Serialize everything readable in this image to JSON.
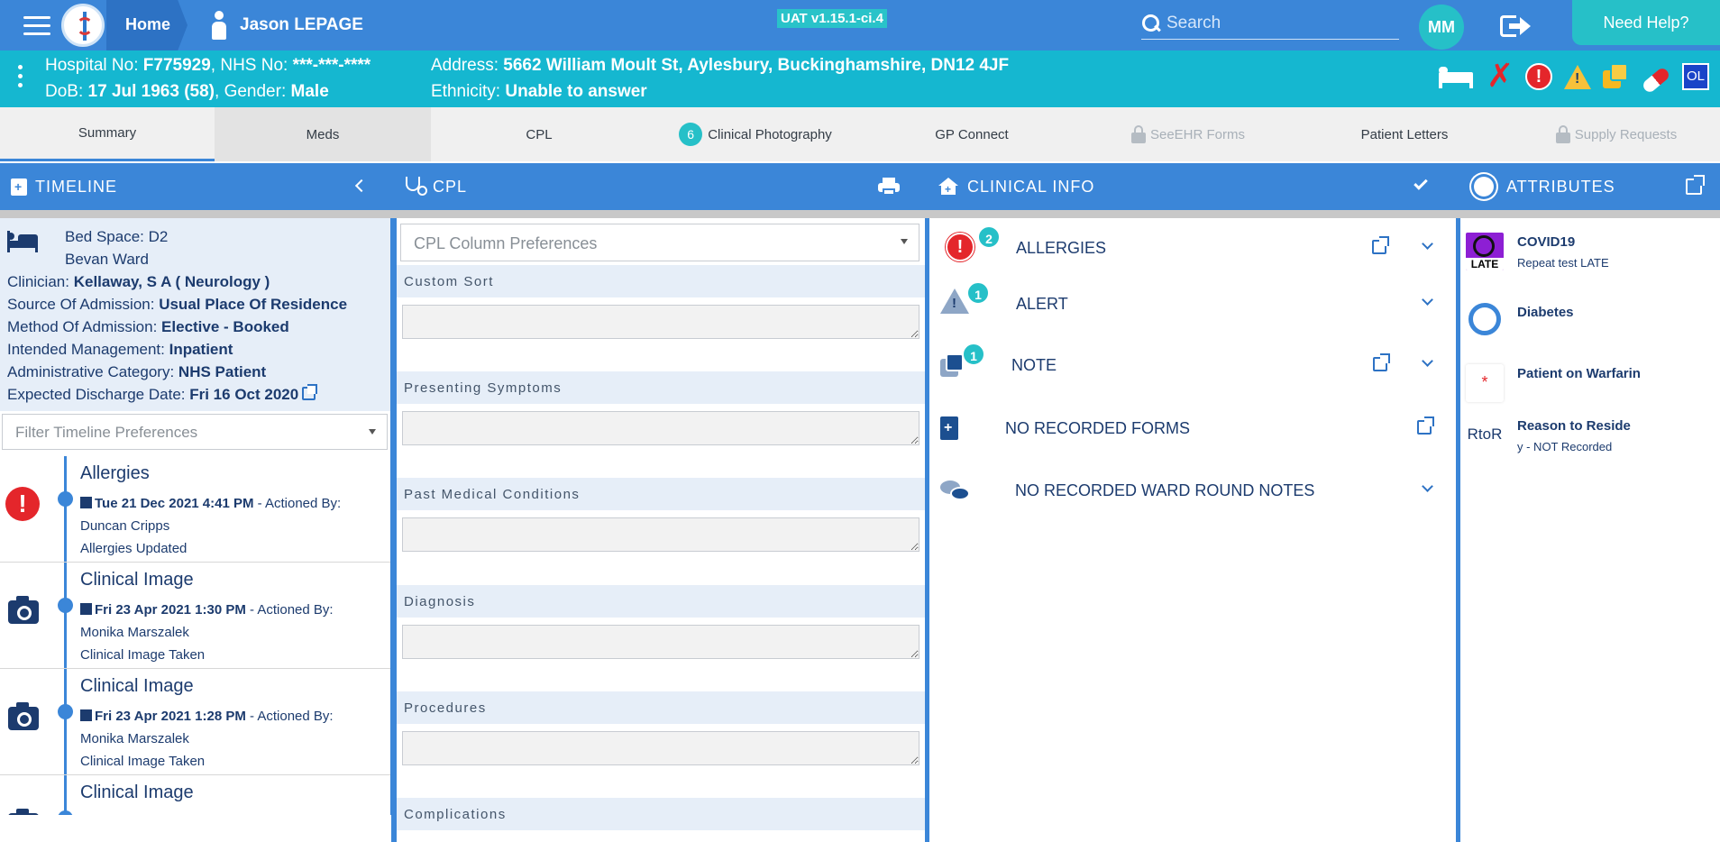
{
  "topbar": {
    "home_label": "Home",
    "patient_name": "Jason LEPAGE",
    "version": "UAT v1.15.1-ci.4",
    "search_placeholder": "Search",
    "avatar_initials": "MM",
    "help_label": "Need Help?"
  },
  "banner": {
    "hospital_label": "Hospital No:",
    "hospital_no": "F775929",
    "nhs_label": "NHS No:",
    "nhs_no": "***-***-****",
    "dob_label": "DoB:",
    "dob": "17 Jul 1963 (58)",
    "gender_label": "Gender:",
    "gender": "Male",
    "address_label": "Address:",
    "address": "5662 William Moult St, Aylesbury, Buckinghamshire, DN12 4JF",
    "ethnicity_label": "Ethnicity:",
    "ethnicity": "Unable to answer",
    "ol_badge": "OL"
  },
  "tabs": [
    {
      "label": "Summary",
      "badge": ""
    },
    {
      "label": "Meds",
      "badge": ""
    },
    {
      "label": "CPL",
      "badge": ""
    },
    {
      "label": "Clinical Photography",
      "badge": "6"
    },
    {
      "label": "GP Connect",
      "badge": ""
    },
    {
      "label": "SeeEHR Forms",
      "badge": ""
    },
    {
      "label": "Patient Letters",
      "badge": ""
    },
    {
      "label": "Supply Requests",
      "badge": ""
    }
  ],
  "panels": {
    "timeline_title": "TIMELINE",
    "cpl_title": "CPL",
    "clinical_title": "CLINICAL INFO",
    "attributes_title": "ATTRIBUTES"
  },
  "timeline": {
    "bed_space_label": "Bed Space:",
    "bed_space": "D2",
    "ward": "Bevan Ward",
    "clinician_label": "Clinician:",
    "clinician": "Kellaway, S A ( Neurology )",
    "source_label": "Source Of Admission:",
    "source": "Usual Place Of Residence",
    "method_label": "Method Of Admission:",
    "method": "Elective - Booked",
    "management_label": "Intended Management:",
    "management": "Inpatient",
    "category_label": "Administrative Category:",
    "category": "NHS Patient",
    "discharge_label": "Expected Discharge Date:",
    "discharge": "Fri 16 Oct 2020",
    "filter_placeholder": "Filter Timeline Preferences",
    "events": [
      {
        "title": "Allergies",
        "datetime": "Tue 21 Dec 2021 4:41 PM",
        "actioned_label": "- Actioned By:",
        "by": "Duncan Cripps",
        "desc": "Allergies Updated",
        "icon": "error-icon"
      },
      {
        "title": "Clinical Image",
        "datetime": "Fri 23 Apr 2021 1:30 PM",
        "actioned_label": "- Actioned By:",
        "by": "Monika Marszalek",
        "desc": "Clinical Image Taken",
        "icon": "camera-icon"
      },
      {
        "title": "Clinical Image",
        "datetime": "Fri 23 Apr 2021 1:28 PM",
        "actioned_label": "- Actioned By:",
        "by": "Monika Marszalek",
        "desc": "Clinical Image Taken",
        "icon": "camera-icon"
      },
      {
        "title": "Clinical Image",
        "datetime": "",
        "actioned_label": "",
        "by": "",
        "desc": "",
        "icon": "camera-icon"
      }
    ]
  },
  "cpl": {
    "column_prefs_placeholder": "CPL Column Preferences",
    "sections": [
      "Custom Sort",
      "Presenting Symptoms",
      "Past Medical Conditions",
      "Diagnosis",
      "Procedures",
      "Complications"
    ]
  },
  "clinical_info": {
    "allergies_label": "ALLERGIES",
    "allergies_count": "2",
    "alert_label": "ALERT",
    "alert_count": "1",
    "note_label": "NOTE",
    "note_count": "1",
    "forms_label": "NO RECORDED FORMS",
    "ward_round_label": "NO RECORDED WARD ROUND NOTES"
  },
  "attributes": [
    {
      "name": "COVID19",
      "sub": "Repeat test LATE",
      "icon_text": "LATE"
    },
    {
      "name": "Diabetes",
      "sub": "",
      "icon_text": ""
    },
    {
      "name": "Patient on Warfarin",
      "sub": "",
      "icon_text": "*"
    },
    {
      "name": "Reason to Reside",
      "sub": "y - NOT Recorded",
      "icon_text": "RtoR"
    }
  ],
  "colors": {
    "primary": "#3b86d8",
    "banner": "#15b7d0",
    "accent": "#26c0c8",
    "danger": "#e4262b",
    "warning": "#f7c13a"
  }
}
